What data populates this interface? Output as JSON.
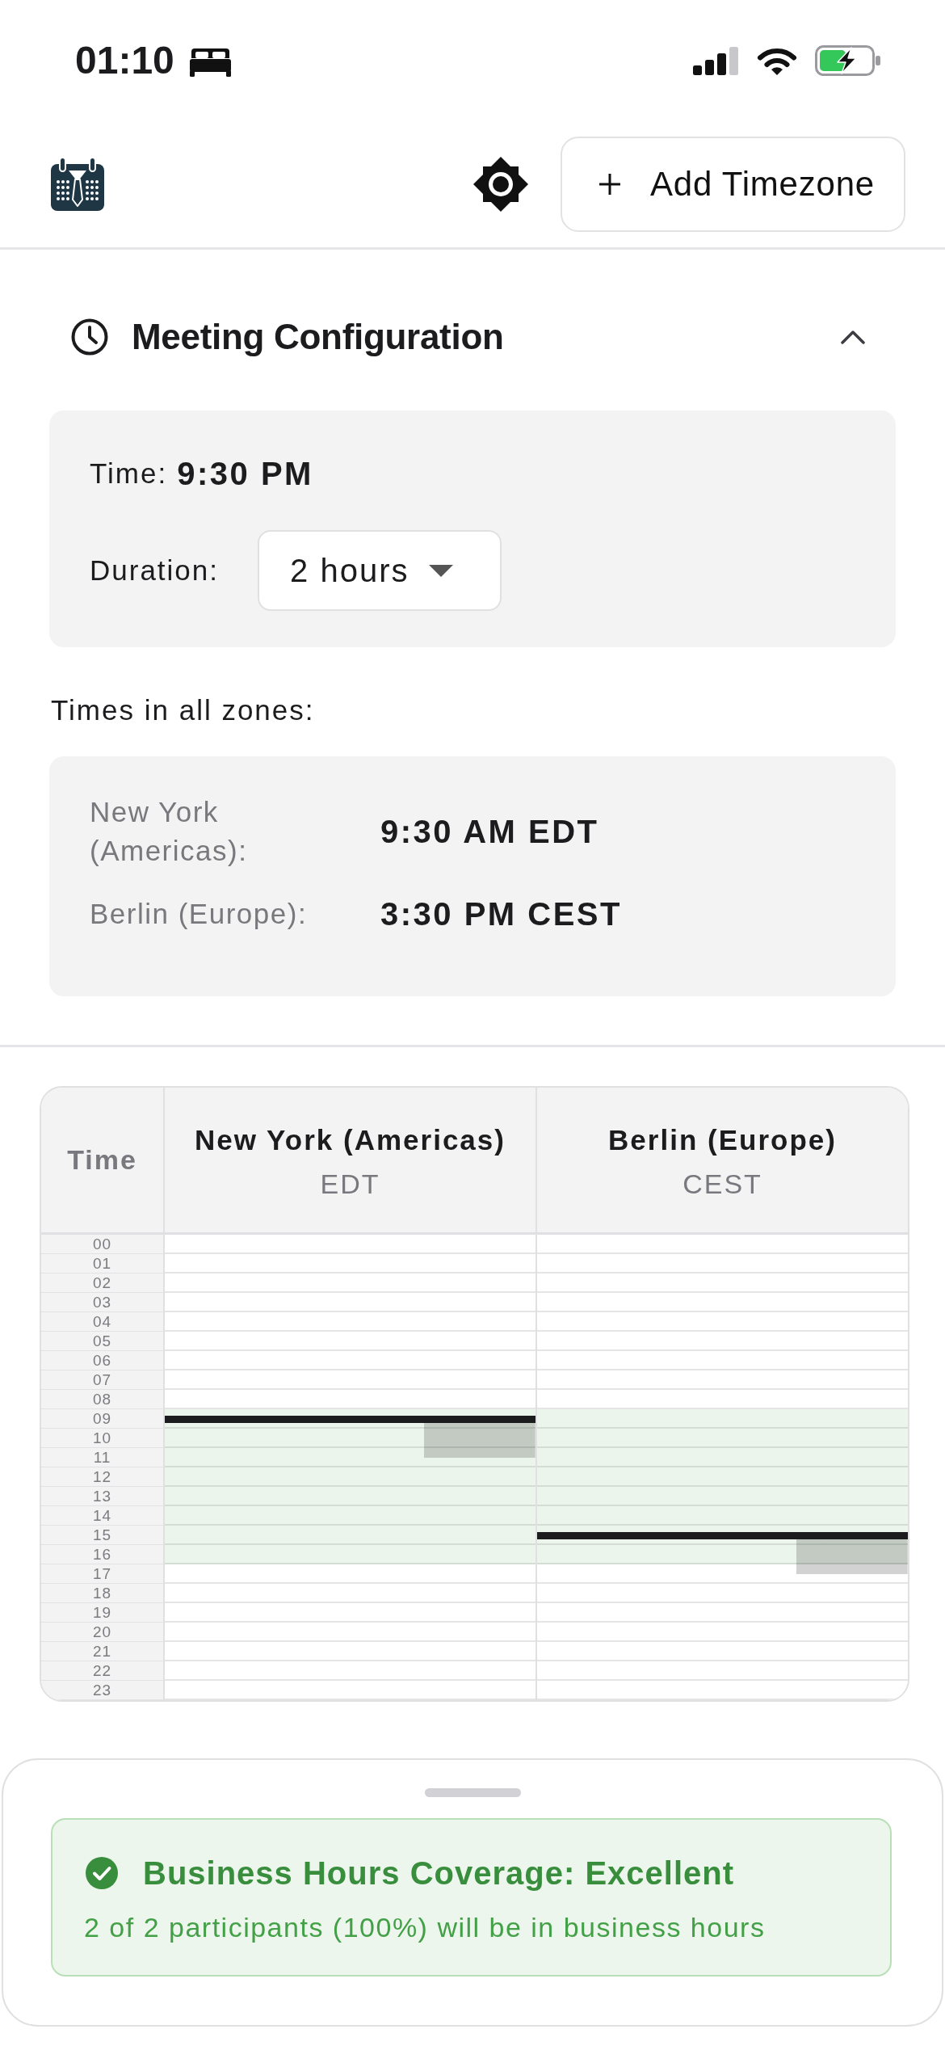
{
  "status_bar": {
    "time": "01:10"
  },
  "header": {
    "add_button": {
      "label": "Add Timezone"
    }
  },
  "meeting_config": {
    "title": "Meeting Configuration",
    "expanded": true,
    "time": {
      "label": "Time:",
      "value": "9:30 PM"
    },
    "duration": {
      "label": "Duration:",
      "value": "2 hours"
    },
    "zones_heading": "Times in all zones:",
    "zone_times": [
      {
        "zone": "New York (Americas):",
        "time": "9:30 AM EDT"
      },
      {
        "zone": "Berlin (Europe):",
        "time": "3:30 PM CEST"
      }
    ]
  },
  "timeline": {
    "time_heading": "Time",
    "columns": [
      {
        "name": "New York (Americas)",
        "abbreviation": "EDT"
      },
      {
        "name": "Berlin (Europe)",
        "abbreviation": "CEST"
      }
    ],
    "rows": [
      {
        "hour": "00",
        "cells": [
          {
            "business_hours": false,
            "meeting_start": false,
            "in_meeting": false
          },
          {
            "business_hours": false,
            "meeting_start": false,
            "in_meeting": false
          }
        ]
      },
      {
        "hour": "01",
        "cells": [
          {
            "business_hours": false,
            "meeting_start": false,
            "in_meeting": false
          },
          {
            "business_hours": false,
            "meeting_start": false,
            "in_meeting": false
          }
        ]
      },
      {
        "hour": "02",
        "cells": [
          {
            "business_hours": false,
            "meeting_start": false,
            "in_meeting": false
          },
          {
            "business_hours": false,
            "meeting_start": false,
            "in_meeting": false
          }
        ]
      },
      {
        "hour": "03",
        "cells": [
          {
            "business_hours": false,
            "meeting_start": false,
            "in_meeting": false
          },
          {
            "business_hours": false,
            "meeting_start": false,
            "in_meeting": false
          }
        ]
      },
      {
        "hour": "04",
        "cells": [
          {
            "business_hours": false,
            "meeting_start": false,
            "in_meeting": false
          },
          {
            "business_hours": false,
            "meeting_start": false,
            "in_meeting": false
          }
        ]
      },
      {
        "hour": "05",
        "cells": [
          {
            "business_hours": false,
            "meeting_start": false,
            "in_meeting": false
          },
          {
            "business_hours": false,
            "meeting_start": false,
            "in_meeting": false
          }
        ]
      },
      {
        "hour": "06",
        "cells": [
          {
            "business_hours": false,
            "meeting_start": false,
            "in_meeting": false
          },
          {
            "business_hours": false,
            "meeting_start": false,
            "in_meeting": false
          }
        ]
      },
      {
        "hour": "07",
        "cells": [
          {
            "business_hours": false,
            "meeting_start": false,
            "in_meeting": false
          },
          {
            "business_hours": false,
            "meeting_start": false,
            "in_meeting": false
          }
        ]
      },
      {
        "hour": "08",
        "cells": [
          {
            "business_hours": false,
            "meeting_start": false,
            "in_meeting": false
          },
          {
            "business_hours": false,
            "meeting_start": false,
            "in_meeting": false
          }
        ]
      },
      {
        "hour": "09",
        "cells": [
          {
            "business_hours": true,
            "meeting_start": true,
            "in_meeting": true
          },
          {
            "business_hours": true,
            "meeting_start": false,
            "in_meeting": false
          }
        ]
      },
      {
        "hour": "10",
        "cells": [
          {
            "business_hours": true,
            "meeting_start": false,
            "in_meeting": true
          },
          {
            "business_hours": true,
            "meeting_start": false,
            "in_meeting": false
          }
        ]
      },
      {
        "hour": "11",
        "cells": [
          {
            "business_hours": true,
            "meeting_start": false,
            "in_meeting": true
          },
          {
            "business_hours": true,
            "meeting_start": false,
            "in_meeting": false
          }
        ]
      },
      {
        "hour": "12",
        "cells": [
          {
            "business_hours": true,
            "meeting_start": false,
            "in_meeting": false
          },
          {
            "business_hours": true,
            "meeting_start": false,
            "in_meeting": false
          }
        ]
      },
      {
        "hour": "13",
        "cells": [
          {
            "business_hours": true,
            "meeting_start": false,
            "in_meeting": false
          },
          {
            "business_hours": true,
            "meeting_start": false,
            "in_meeting": false
          }
        ]
      },
      {
        "hour": "14",
        "cells": [
          {
            "business_hours": true,
            "meeting_start": false,
            "in_meeting": false
          },
          {
            "business_hours": true,
            "meeting_start": false,
            "in_meeting": false
          }
        ]
      },
      {
        "hour": "15",
        "cells": [
          {
            "business_hours": true,
            "meeting_start": false,
            "in_meeting": false
          },
          {
            "business_hours": true,
            "meeting_start": true,
            "in_meeting": true
          }
        ]
      },
      {
        "hour": "16",
        "cells": [
          {
            "business_hours": true,
            "meeting_start": false,
            "in_meeting": false
          },
          {
            "business_hours": true,
            "meeting_start": false,
            "in_meeting": true
          }
        ]
      },
      {
        "hour": "17",
        "cells": [
          {
            "business_hours": false,
            "meeting_start": false,
            "in_meeting": false
          },
          {
            "business_hours": false,
            "meeting_start": false,
            "in_meeting": true
          }
        ]
      },
      {
        "hour": "18",
        "cells": [
          {
            "business_hours": false,
            "meeting_start": false,
            "in_meeting": false
          },
          {
            "business_hours": false,
            "meeting_start": false,
            "in_meeting": false
          }
        ]
      },
      {
        "hour": "19",
        "cells": [
          {
            "business_hours": false,
            "meeting_start": false,
            "in_meeting": false
          },
          {
            "business_hours": false,
            "meeting_start": false,
            "in_meeting": false
          }
        ]
      },
      {
        "hour": "20",
        "cells": [
          {
            "business_hours": false,
            "meeting_start": false,
            "in_meeting": false
          },
          {
            "business_hours": false,
            "meeting_start": false,
            "in_meeting": false
          }
        ]
      },
      {
        "hour": "21",
        "cells": [
          {
            "business_hours": false,
            "meeting_start": false,
            "in_meeting": false
          },
          {
            "business_hours": false,
            "meeting_start": false,
            "in_meeting": false
          }
        ]
      },
      {
        "hour": "22",
        "cells": [
          {
            "business_hours": false,
            "meeting_start": false,
            "in_meeting": false
          },
          {
            "business_hours": false,
            "meeting_start": false,
            "in_meeting": false
          }
        ]
      },
      {
        "hour": "23",
        "cells": [
          {
            "business_hours": false,
            "meeting_start": false,
            "in_meeting": false
          },
          {
            "business_hours": false,
            "meeting_start": false,
            "in_meeting": false
          }
        ]
      }
    ]
  },
  "coverage": {
    "kind": "success",
    "title": "Business Hours Coverage: Excellent",
    "detail": "2 of 2 participants (100%) will be in business hours"
  }
}
